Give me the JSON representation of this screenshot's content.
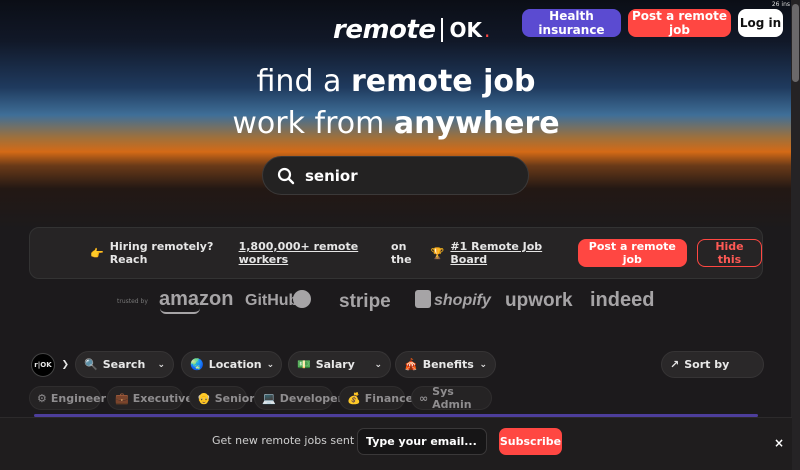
{
  "header": {
    "logo_text": "remote",
    "logo_ok": "OK",
    "logo_dot": ".",
    "health_label": "Health insurance",
    "post_label": "Post a remote job",
    "login_label": "Log in",
    "corner_note": "26 ins"
  },
  "hero": {
    "line1_prefix": "find a ",
    "line1_bold": "remote job",
    "line2_prefix": "work from ",
    "line2_bold": "anywhere",
    "search_value": "senior"
  },
  "banner": {
    "emoji_hand": "👉",
    "text_a": "Hiring remotely? Reach",
    "link_workers": "1,800,000+ remote workers",
    "text_b": "on the",
    "emoji_trophy": "🏆",
    "link_board": "#1 Remote Job Board",
    "post_label": "Post a remote job",
    "hide_label": "Hide this"
  },
  "trusted": {
    "label": "trusted by",
    "brands": [
      "amazon",
      "GitHub",
      "stripe",
      "shopify",
      "upwork",
      "indeed"
    ]
  },
  "filters": {
    "logo_mini": "r|OK",
    "search": "Search",
    "location": "Location",
    "salary": "Salary",
    "benefits": "Benefits",
    "sort": "Sort by"
  },
  "tags": [
    "Engineer",
    "Executive",
    "Senior",
    "Developer",
    "Finance",
    "Sys Admin"
  ],
  "footer": {
    "text": "Get new remote jobs sent to",
    "email_placeholder": "Type your email...",
    "subscribe": "Subscribe",
    "close": "×"
  },
  "colors": {
    "accent_red": "#ff4742",
    "accent_purple": "#5b4bd1",
    "background": "#1c1a1c"
  }
}
